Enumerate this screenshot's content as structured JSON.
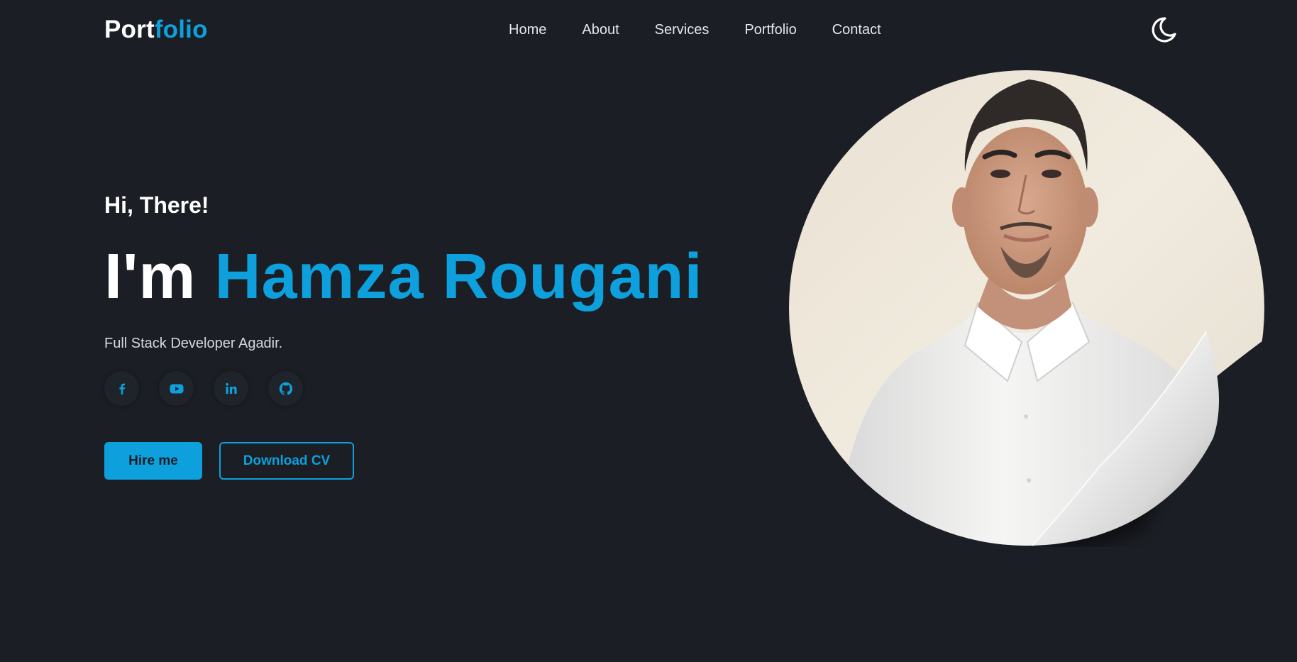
{
  "logo": {
    "part1": "Port",
    "part2": "folio"
  },
  "nav": {
    "items": [
      {
        "label": "Home"
      },
      {
        "label": "About"
      },
      {
        "label": "Services"
      },
      {
        "label": "Portfolio"
      },
      {
        "label": "Contact"
      }
    ]
  },
  "theme_toggle": {
    "icon": "moon-icon"
  },
  "hero": {
    "greeting": "Hi, There!",
    "im": "I'm",
    "name": "Hamza Rougani",
    "subtitle": "Full Stack Developer Agadir.",
    "socials": [
      {
        "icon": "facebook-icon"
      },
      {
        "icon": "youtube-icon"
      },
      {
        "icon": "linkedin-icon"
      },
      {
        "icon": "github-icon"
      }
    ],
    "hire_label": "Hire me",
    "cv_label": "Download CV"
  },
  "colors": {
    "background": "#1b1e24",
    "accent": "#0ea0dc",
    "text": "#ffffff"
  }
}
